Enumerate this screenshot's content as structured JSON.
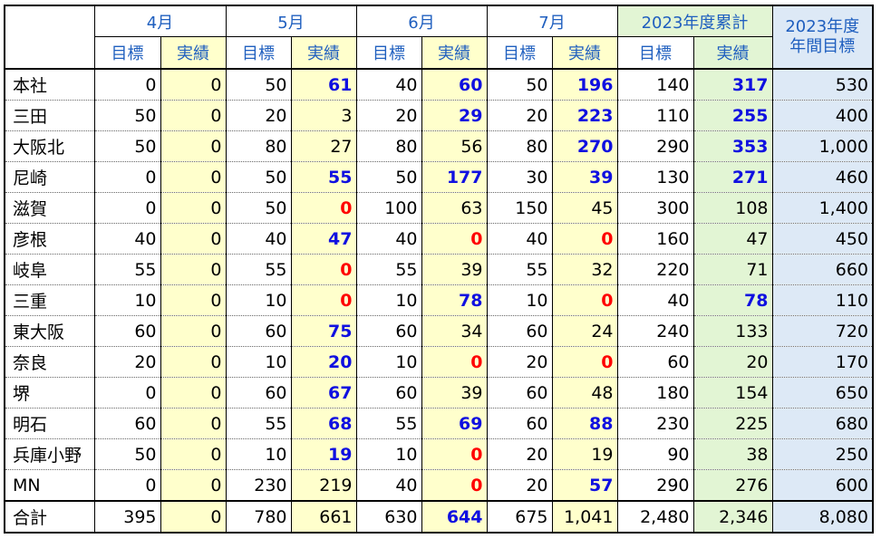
{
  "header": {
    "months": [
      "4月",
      "5月",
      "6月",
      "7月"
    ],
    "cumulative": "2023年度累計",
    "annual_line1": "2023年度",
    "annual_line2": "年間目標",
    "target": "目標",
    "actual": "実績"
  },
  "colors": {
    "blue_value": "#1010e0",
    "red_value": "#ff0000",
    "actual_bg": "#ffffcc",
    "cum_bg": "#e2f5d4",
    "annual_bg": "#dde9f6"
  },
  "rows": [
    {
      "name": "本社",
      "c": [
        {
          "v": "0"
        },
        {
          "v": "0"
        },
        {
          "v": "50"
        },
        {
          "v": "61",
          "s": "blue"
        },
        {
          "v": "40"
        },
        {
          "v": "60",
          "s": "blue"
        },
        {
          "v": "50"
        },
        {
          "v": "196",
          "s": "blue"
        },
        {
          "v": "140"
        },
        {
          "v": "317",
          "s": "blue"
        },
        {
          "v": "530"
        }
      ]
    },
    {
      "name": "三田",
      "c": [
        {
          "v": "50"
        },
        {
          "v": "0"
        },
        {
          "v": "20"
        },
        {
          "v": "3"
        },
        {
          "v": "20"
        },
        {
          "v": "29",
          "s": "blue"
        },
        {
          "v": "20"
        },
        {
          "v": "223",
          "s": "blue"
        },
        {
          "v": "110"
        },
        {
          "v": "255",
          "s": "blue"
        },
        {
          "v": "400"
        }
      ]
    },
    {
      "name": "大阪北",
      "c": [
        {
          "v": "50"
        },
        {
          "v": "0"
        },
        {
          "v": "80"
        },
        {
          "v": "27"
        },
        {
          "v": "80"
        },
        {
          "v": "56"
        },
        {
          "v": "80"
        },
        {
          "v": "270",
          "s": "blue"
        },
        {
          "v": "290"
        },
        {
          "v": "353",
          "s": "blue"
        },
        {
          "v": "1,000"
        }
      ]
    },
    {
      "name": "尼崎",
      "c": [
        {
          "v": "0"
        },
        {
          "v": "0"
        },
        {
          "v": "50"
        },
        {
          "v": "55",
          "s": "blue"
        },
        {
          "v": "50"
        },
        {
          "v": "177",
          "s": "blue"
        },
        {
          "v": "30"
        },
        {
          "v": "39",
          "s": "blue"
        },
        {
          "v": "130"
        },
        {
          "v": "271",
          "s": "blue"
        },
        {
          "v": "460"
        }
      ]
    },
    {
      "name": "滋賀",
      "c": [
        {
          "v": "0"
        },
        {
          "v": "0"
        },
        {
          "v": "50"
        },
        {
          "v": "0",
          "s": "red"
        },
        {
          "v": "100"
        },
        {
          "v": "63"
        },
        {
          "v": "150"
        },
        {
          "v": "45"
        },
        {
          "v": "300"
        },
        {
          "v": "108"
        },
        {
          "v": "1,400"
        }
      ]
    },
    {
      "name": "彦根",
      "c": [
        {
          "v": "40"
        },
        {
          "v": "0"
        },
        {
          "v": "40"
        },
        {
          "v": "47",
          "s": "blue"
        },
        {
          "v": "40"
        },
        {
          "v": "0",
          "s": "red"
        },
        {
          "v": "40"
        },
        {
          "v": "0",
          "s": "red"
        },
        {
          "v": "160"
        },
        {
          "v": "47"
        },
        {
          "v": "450"
        }
      ]
    },
    {
      "name": "岐阜",
      "c": [
        {
          "v": "55"
        },
        {
          "v": "0"
        },
        {
          "v": "55"
        },
        {
          "v": "0",
          "s": "red"
        },
        {
          "v": "55"
        },
        {
          "v": "39"
        },
        {
          "v": "55"
        },
        {
          "v": "32"
        },
        {
          "v": "220"
        },
        {
          "v": "71"
        },
        {
          "v": "660"
        }
      ]
    },
    {
      "name": "三重",
      "c": [
        {
          "v": "10"
        },
        {
          "v": "0"
        },
        {
          "v": "10"
        },
        {
          "v": "0",
          "s": "red"
        },
        {
          "v": "10"
        },
        {
          "v": "78",
          "s": "blue"
        },
        {
          "v": "10"
        },
        {
          "v": "0",
          "s": "red"
        },
        {
          "v": "40"
        },
        {
          "v": "78",
          "s": "blue"
        },
        {
          "v": "110"
        }
      ]
    },
    {
      "name": "東大阪",
      "c": [
        {
          "v": "60"
        },
        {
          "v": "0"
        },
        {
          "v": "60"
        },
        {
          "v": "75",
          "s": "blue"
        },
        {
          "v": "60"
        },
        {
          "v": "34"
        },
        {
          "v": "60"
        },
        {
          "v": "24"
        },
        {
          "v": "240"
        },
        {
          "v": "133"
        },
        {
          "v": "720"
        }
      ]
    },
    {
      "name": "奈良",
      "c": [
        {
          "v": "20"
        },
        {
          "v": "0"
        },
        {
          "v": "10"
        },
        {
          "v": "20",
          "s": "blue"
        },
        {
          "v": "10"
        },
        {
          "v": "0",
          "s": "red"
        },
        {
          "v": "20"
        },
        {
          "v": "0",
          "s": "red"
        },
        {
          "v": "60"
        },
        {
          "v": "20"
        },
        {
          "v": "170"
        }
      ]
    },
    {
      "name": "堺",
      "c": [
        {
          "v": "0"
        },
        {
          "v": "0"
        },
        {
          "v": "60"
        },
        {
          "v": "67",
          "s": "blue"
        },
        {
          "v": "60"
        },
        {
          "v": "39"
        },
        {
          "v": "60"
        },
        {
          "v": "48"
        },
        {
          "v": "180"
        },
        {
          "v": "154"
        },
        {
          "v": "650"
        }
      ]
    },
    {
      "name": "明石",
      "c": [
        {
          "v": "60"
        },
        {
          "v": "0"
        },
        {
          "v": "55"
        },
        {
          "v": "68",
          "s": "blue"
        },
        {
          "v": "55"
        },
        {
          "v": "69",
          "s": "blue"
        },
        {
          "v": "60"
        },
        {
          "v": "88",
          "s": "blue"
        },
        {
          "v": "230"
        },
        {
          "v": "225"
        },
        {
          "v": "680"
        }
      ]
    },
    {
      "name": "兵庫小野",
      "c": [
        {
          "v": "50"
        },
        {
          "v": "0"
        },
        {
          "v": "10"
        },
        {
          "v": "19",
          "s": "blue"
        },
        {
          "v": "10"
        },
        {
          "v": "0",
          "s": "red"
        },
        {
          "v": "20"
        },
        {
          "v": "19"
        },
        {
          "v": "90"
        },
        {
          "v": "38"
        },
        {
          "v": "250"
        }
      ]
    },
    {
      "name": "MN",
      "c": [
        {
          "v": "0"
        },
        {
          "v": "0"
        },
        {
          "v": "230"
        },
        {
          "v": "219"
        },
        {
          "v": "40"
        },
        {
          "v": "0",
          "s": "red"
        },
        {
          "v": "20"
        },
        {
          "v": "57",
          "s": "blue"
        },
        {
          "v": "290"
        },
        {
          "v": "276"
        },
        {
          "v": "600"
        }
      ]
    }
  ],
  "total": {
    "name": "合計",
    "c": [
      {
        "v": "395"
      },
      {
        "v": "0"
      },
      {
        "v": "780"
      },
      {
        "v": "661"
      },
      {
        "v": "630"
      },
      {
        "v": "644",
        "s": "blue"
      },
      {
        "v": "675"
      },
      {
        "v": "1,041"
      },
      {
        "v": "2,480"
      },
      {
        "v": "2,346"
      },
      {
        "v": "8,080"
      }
    ]
  }
}
